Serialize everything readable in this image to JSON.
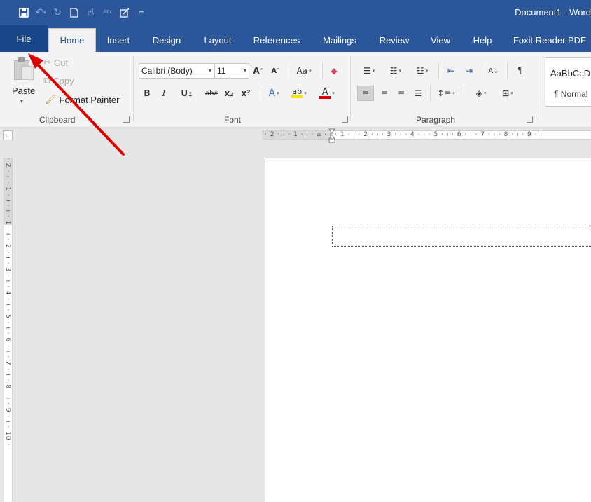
{
  "app": {
    "document_title": "Document1  -  Word",
    "accent_color": "#2b579a",
    "quick_access": [
      {
        "icon": "save-icon",
        "glyph": "🖫"
      },
      {
        "icon": "undo-icon",
        "glyph": "↶"
      },
      {
        "icon": "redo-icon",
        "glyph": "↻"
      },
      {
        "icon": "new-document-icon",
        "glyph": "🗋"
      },
      {
        "icon": "touch-mode-icon",
        "glyph": "☝"
      },
      {
        "icon": "spelling-icon",
        "glyph": "✓"
      },
      {
        "icon": "draw-table-icon",
        "glyph": "▦"
      },
      {
        "icon": "customize-qat-icon",
        "glyph": "▾"
      }
    ]
  },
  "tabs": {
    "file": "File",
    "home": "Home",
    "insert": "Insert",
    "design": "Design",
    "layout": "Layout",
    "references": "References",
    "mailings": "Mailings",
    "review": "Review",
    "view": "View",
    "help": "Help",
    "foxit": "Foxit Reader PDF"
  },
  "clipboard": {
    "paste": "Paste",
    "cut": "Cut",
    "copy": "Copy",
    "format_painter": "Format Painter",
    "group_label": "Clipboard"
  },
  "font": {
    "family": "Calibri (Body)",
    "size": "11",
    "grow": "A",
    "shrink": "A",
    "change_case": "Aa",
    "bold": "B",
    "italic": "I",
    "underline": "U",
    "strikethrough": "abc",
    "subscript": "x₂",
    "superscript": "x²",
    "text_effects": "A",
    "highlight": "ab",
    "font_color": "A",
    "group_label": "Font",
    "highlight_color": "#f5e400",
    "font_color_value": "#d40000"
  },
  "paragraph": {
    "group_label": "Paragraph",
    "sort": "A↓",
    "pilcrow": "¶"
  },
  "styles": {
    "sample": "AaBbCcD",
    "name": "¶ Normal"
  },
  "ruler": {
    "horizontal": "· 2 · ı · 1 · ı · ⌂ · ı · 1 · ı · 2 · ı · 3 · ı · 4 · ı · 5 · ı · 6 · ı · 7 · ı · 8 · ı · 9 · ı",
    "vertical": "· 2 · ı · 1 · ı · ı · 1 · ı · 2 · ı · 3 · ı · 4 · ı · 5 · ı · 6 · ı · 7 · ı · 8 · ı · 9 · ı · 10 ·"
  },
  "annotation": {
    "arrow_color": "#e00000"
  }
}
